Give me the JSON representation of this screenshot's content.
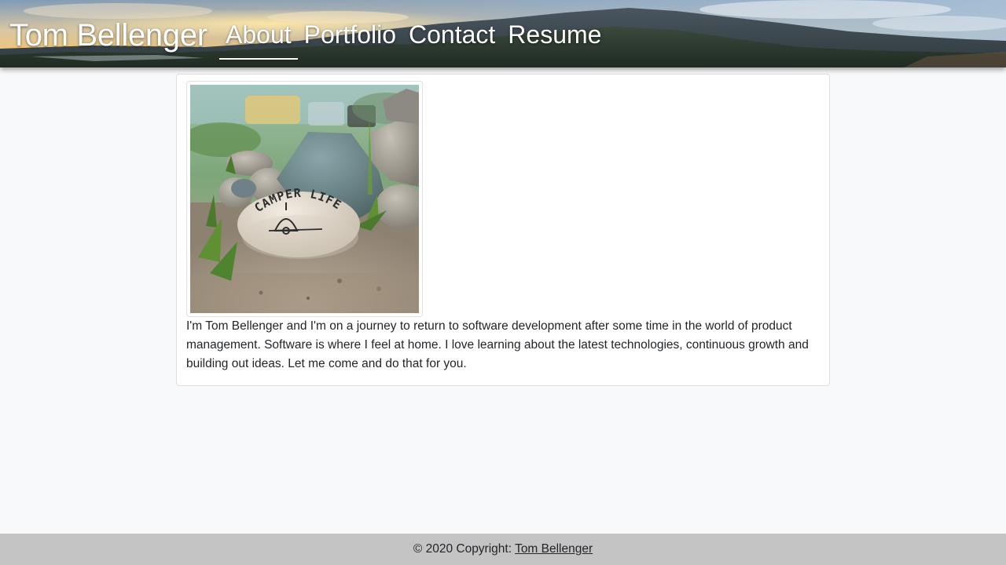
{
  "header": {
    "brand": "Tom Bellenger",
    "nav": [
      {
        "label": "About",
        "active": true
      },
      {
        "label": "Portfolio",
        "active": false
      },
      {
        "label": "Contact",
        "active": false
      },
      {
        "label": "Resume",
        "active": false
      }
    ]
  },
  "about": {
    "photo_icon": "campsite-rock-photo",
    "photo_caption": "CAMPER LIFE",
    "bio": "I'm Tom Bellenger and I'm on a journey to return to software development after some time in the world of product management. Software is where I feel at home. I love learning about the latest technologies, continuous growth and building out ideas. Let me come and do that for you."
  },
  "footer": {
    "copyright": "© 2020 Copyright:",
    "author_link": "Tom Bellenger"
  },
  "colors": {
    "page_bg": "#f8f9fa",
    "footer_bg": "#c4c4c4",
    "header_text": "#ffffff",
    "body_text": "#212529"
  }
}
